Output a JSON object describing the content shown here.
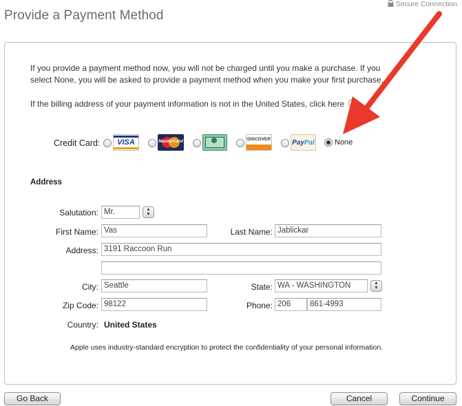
{
  "header": {
    "title": "Provide a Payment Method",
    "secure_text": "Secure Connection"
  },
  "intro": {
    "text": "If you provide a payment method now, you will not be charged until you make a purchase. If you select None, you will be asked to provide a payment method when you make your first purchase.",
    "billing_text": "If the billing address of your payment information is not in the United States, click here"
  },
  "payment": {
    "label": "Credit Card:",
    "options": [
      {
        "name": "visa",
        "text": "VISA",
        "selected": false
      },
      {
        "name": "mastercard",
        "text": "MasterCard",
        "selected": false
      },
      {
        "name": "amex",
        "text": "",
        "selected": false
      },
      {
        "name": "discover",
        "text": "DISCOVER",
        "selected": false
      },
      {
        "name": "paypal",
        "text": "PayPal",
        "selected": false
      },
      {
        "name": "none",
        "text": "None",
        "selected": true
      }
    ],
    "visa_text": "VISA",
    "mc_text": "MasterCard",
    "discover_text": "DISCOVER",
    "paypal_text_a": "Pay",
    "paypal_text_b": "Pal",
    "none_label": "None"
  },
  "address": {
    "section_title": "Address",
    "salutation_label": "Salutation:",
    "salutation_value": "Mr.",
    "first_name_label": "First Name:",
    "first_name_value": "Vas",
    "last_name_label": "Last Name:",
    "last_name_value": "Jablickar",
    "address_label": "Address:",
    "address_line1": "3191 Raccoon Run",
    "address_line2": "",
    "city_label": "City:",
    "city_value": "Seattle",
    "state_label": "State:",
    "state_value": "WA - WASHINGTON",
    "zip_label": "Zip Code:",
    "zip_value": "98122",
    "phone_label": "Phone:",
    "phone_area": "206",
    "phone_number": "861-4993",
    "country_label": "Country:",
    "country_value": "United States"
  },
  "footnote": "Apple uses industry-standard encryption to protect the confidentiality of your personal information.",
  "buttons": {
    "go_back": "Go Back",
    "cancel": "Cancel",
    "continue": "Continue"
  },
  "colors": {
    "arrow": "#e8392a",
    "title": "#6b6b6b"
  }
}
